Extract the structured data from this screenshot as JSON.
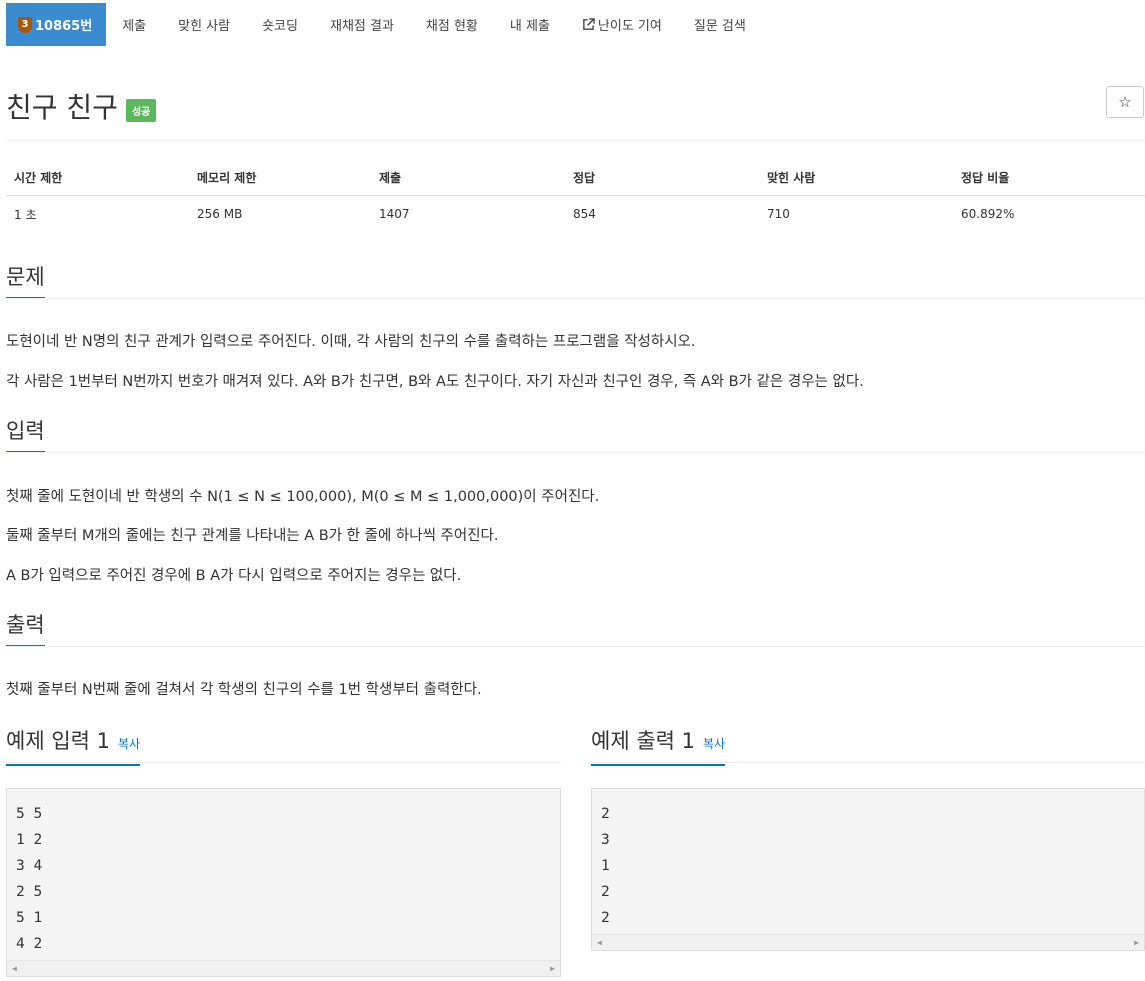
{
  "nav": {
    "items": [
      {
        "label": "10865번",
        "active": true,
        "tier": "3"
      },
      {
        "label": "제출"
      },
      {
        "label": "맞힌 사람"
      },
      {
        "label": "숏코딩"
      },
      {
        "label": "재채점 결과"
      },
      {
        "label": "채점 현황"
      },
      {
        "label": "내 제출"
      },
      {
        "label": "난이도 기여",
        "icon": "external-link-icon"
      },
      {
        "label": "질문 검색"
      }
    ]
  },
  "problem": {
    "title": "친구 친구",
    "status_badge": "성공",
    "star_icon": "☆"
  },
  "info": {
    "headers": [
      "시간 제한",
      "메모리 제한",
      "제출",
      "정답",
      "맞힌 사람",
      "정답 비율"
    ],
    "values": [
      "1 초",
      "256 MB",
      "1407",
      "854",
      "710",
      "60.892%"
    ]
  },
  "description": {
    "heading": "문제",
    "paragraphs": [
      "도현이네 반 N명의 친구 관계가 입력으로 주어진다. 이때, 각 사람의 친구의 수를 출력하는 프로그램을 작성하시오.",
      "각 사람은 1번부터 N번까지 번호가 매겨져 있다. A와 B가 친구면, B와 A도 친구이다. 자기 자신과 친구인 경우, 즉 A와 B가 같은 경우는 없다."
    ]
  },
  "input": {
    "heading": "입력",
    "paragraphs": [
      "첫째 줄에 도현이네 반 학생의 수 N(1 ≤ N ≤ 100,000), M(0 ≤ M ≤ 1,000,000)이 주어진다.",
      "둘째 줄부터 M개의 줄에는 친구 관계를 나타내는 A B가 한 줄에 하나씩 주어진다.",
      "A B가 입력으로 주어진 경우에 B A가 다시 입력으로 주어지는 경우는 없다."
    ]
  },
  "output": {
    "heading": "출력",
    "paragraphs": [
      "첫째 줄부터 N번째 줄에 걸쳐서 각 학생의 친구의 수를 1번 학생부터 출력한다."
    ]
  },
  "samples": {
    "input_heading": "예제 입력 1",
    "output_heading": "예제 출력 1",
    "copy_label": "복사",
    "input_lines": [
      "5 5",
      "1 2",
      "3 4",
      "2 5",
      "5 1",
      "4 2"
    ],
    "output_lines": [
      "2",
      "3",
      "1",
      "2",
      "2"
    ]
  },
  "colors": {
    "nav_active": "#3b8bd1",
    "success": "#5cb85c",
    "accent": "#0076c0"
  }
}
